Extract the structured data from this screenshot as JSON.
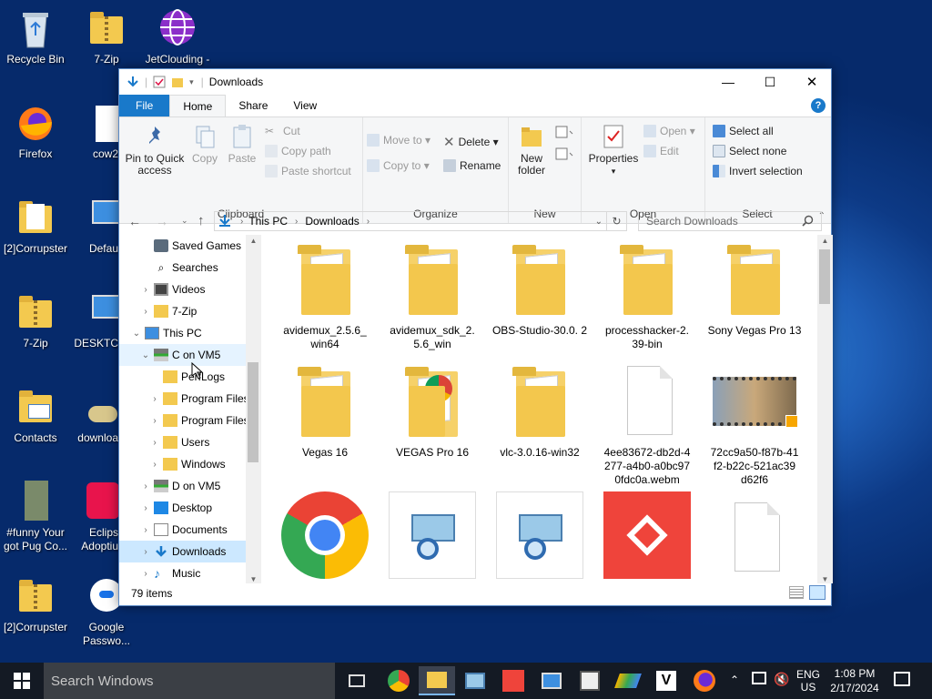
{
  "desktop": {
    "icons": [
      {
        "label": "Recycle Bin",
        "icon": "recycle-bin-icon"
      },
      {
        "label": "7-Zip",
        "icon": "zip-folder-icon"
      },
      {
        "label": "JetClouding -",
        "icon": "globe-icon"
      },
      {
        "label": "Firefox",
        "icon": "firefox-icon"
      },
      {
        "label": "cow2",
        "icon": "file-icon"
      },
      {
        "label": "[2]Corrupster",
        "icon": "file-icon"
      },
      {
        "label": "Defau",
        "icon": "computer-icon"
      },
      {
        "label": "7-Zip",
        "icon": "zip-folder-icon"
      },
      {
        "label": "DESKTC",
        "icon": "computer-icon"
      },
      {
        "label": "Contacts",
        "icon": "contacts-folder-icon"
      },
      {
        "label": "downloa",
        "icon": "disc-icon"
      },
      {
        "label": "#funny Your got Pug Co...",
        "icon": "video-file-icon"
      },
      {
        "label": "Eclips Adoptiu",
        "icon": "eclipse-icon"
      },
      {
        "label": "[2]Corrupster",
        "icon": "zip-folder-icon"
      },
      {
        "label": "Google Passwo...",
        "icon": "key-icon"
      }
    ]
  },
  "window": {
    "title": "Downloads",
    "controls": {
      "minimize": "—",
      "maximize": "☐",
      "close": "✕"
    },
    "tabs": [
      "File",
      "Home",
      "Share",
      "View"
    ],
    "help": "?",
    "ribbon": {
      "clipboard": {
        "name": "Clipboard",
        "pin": "Pin to Quick access",
        "copy": "Copy",
        "paste": "Paste",
        "cut": "Cut",
        "copy_path": "Copy path",
        "paste_shortcut": "Paste shortcut"
      },
      "organize": {
        "name": "Organize",
        "move_to": "Move to",
        "copy_to": "Copy to",
        "delete": "Delete",
        "rename": "Rename"
      },
      "new": {
        "name": "New",
        "new_folder": "New folder"
      },
      "open": {
        "name": "Open",
        "properties": "Properties",
        "open": "Open",
        "edit": "Edit"
      },
      "select": {
        "name": "Select",
        "select_all": "Select all",
        "select_none": "Select none",
        "invert": "Invert selection"
      }
    },
    "address": {
      "segments": [
        "This PC",
        "Downloads"
      ],
      "search_placeholder": "Search Downloads"
    },
    "nav": [
      {
        "label": "Saved Games",
        "indent": 1,
        "expand": ""
      },
      {
        "label": "Searches",
        "indent": 1,
        "expand": ""
      },
      {
        "label": "Videos",
        "indent": 1,
        "expand": "›"
      },
      {
        "label": "7-Zip",
        "indent": 1,
        "expand": "›"
      },
      {
        "label": "This PC",
        "indent": 0,
        "expand": "⌄"
      },
      {
        "label": "C on VM5",
        "indent": 1,
        "expand": "⌄"
      },
      {
        "label": "PerfLogs",
        "indent": 2,
        "expand": ""
      },
      {
        "label": "Program Files",
        "indent": 2,
        "expand": "›"
      },
      {
        "label": "Program Files",
        "indent": 2,
        "expand": "›"
      },
      {
        "label": "Users",
        "indent": 2,
        "expand": "›"
      },
      {
        "label": "Windows",
        "indent": 2,
        "expand": "›"
      },
      {
        "label": "D on VM5",
        "indent": 1,
        "expand": "›"
      },
      {
        "label": "Desktop",
        "indent": 1,
        "expand": "›"
      },
      {
        "label": "Documents",
        "indent": 1,
        "expand": "›"
      },
      {
        "label": "Downloads",
        "indent": 1,
        "expand": "›"
      },
      {
        "label": "Music",
        "indent": 1,
        "expand": "›"
      }
    ],
    "files": [
      {
        "name": "avidemux_2.5.6_ win64",
        "type": "folder"
      },
      {
        "name": "avidemux_sdk_2. 5.6_win",
        "type": "folder"
      },
      {
        "name": "OBS-Studio-30.0. 2",
        "type": "folder"
      },
      {
        "name": "processhacker-2. 39-bin",
        "type": "folder"
      },
      {
        "name": "Sony Vegas Pro 13",
        "type": "folder"
      },
      {
        "name": "Vegas 16",
        "type": "folder"
      },
      {
        "name": "VEGAS Pro 16",
        "type": "folder"
      },
      {
        "name": "vlc-3.0.16-win32",
        "type": "folder"
      },
      {
        "name": "4ee83672-db2d-4 277-a4b0-a0bc97 0fdc0a.webm",
        "type": "document"
      },
      {
        "name": "72cc9a50-f87b-41 f2-b22c-521ac39 d62f6",
        "type": "video"
      },
      {
        "name": "",
        "type": "chrome"
      },
      {
        "name": "",
        "type": "network"
      },
      {
        "name": "",
        "type": "network"
      },
      {
        "name": "",
        "type": "anydesk"
      },
      {
        "name": "",
        "type": "document"
      }
    ],
    "status": "79 items"
  },
  "taskbar": {
    "search_placeholder": "Search Windows",
    "lang": "ENG",
    "region": "US",
    "time": "1:08 PM",
    "date": "2/17/2024"
  },
  "colors": {
    "accent": "#1979ca",
    "selection": "#cce8ff",
    "folder": "#f3c94f"
  }
}
